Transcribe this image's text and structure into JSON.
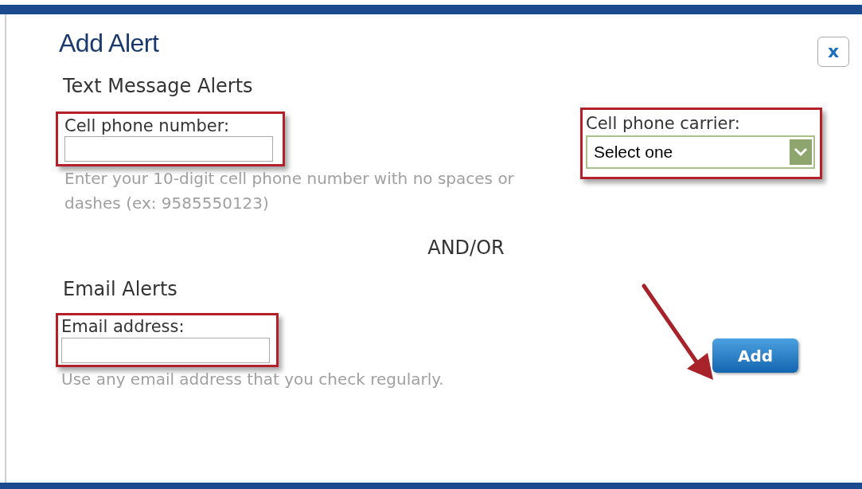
{
  "dialog": {
    "title": "Add Alert",
    "close_label": "x"
  },
  "text_alerts": {
    "heading": "Text Message Alerts",
    "phone": {
      "label": "Cell phone number:",
      "hint": "Enter your 10-digit cell phone number with no spaces or dashes (ex: 9585550123)",
      "highlighted": true
    },
    "carrier": {
      "label": "Cell phone carrier:",
      "value": "Select one",
      "highlighted": true
    }
  },
  "separator": "AND/OR",
  "email_alerts": {
    "heading": "Email Alerts",
    "email": {
      "label": "Email address:",
      "hint": "Use any email address that you check regularly.",
      "highlighted": true
    }
  },
  "add_button": {
    "label": "Add",
    "pointed_at": true
  }
}
